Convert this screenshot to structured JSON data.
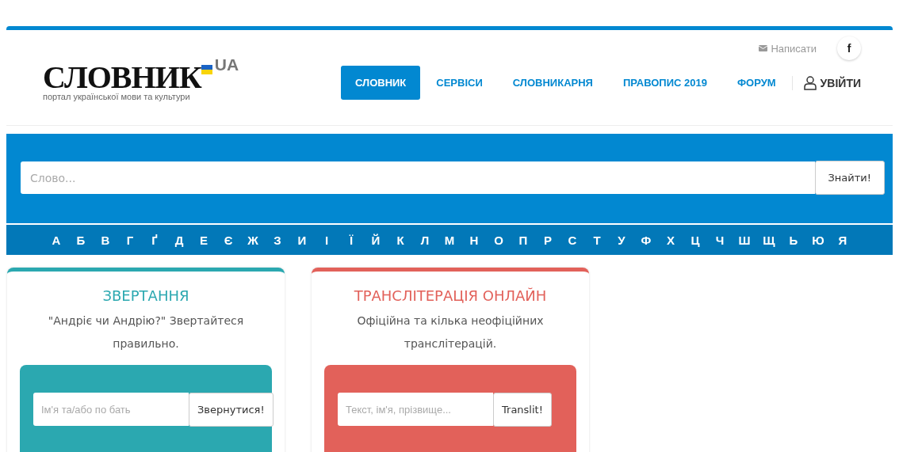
{
  "logo": {
    "title": "СЛОВНИК",
    "suffix": "UA",
    "tagline": "портал української мови та культури"
  },
  "top_links": {
    "write": "Написати",
    "social": "f"
  },
  "nav": [
    {
      "label": "СЛОВНИК",
      "selected": true
    },
    {
      "label": "СЕРВІСИ",
      "selected": false
    },
    {
      "label": "СЛОВНИКАРНЯ",
      "selected": false
    },
    {
      "label": "ПРАВОПИС 2019",
      "selected": false
    },
    {
      "label": "ФОРУМ",
      "selected": false
    }
  ],
  "login": "УВІЙТИ",
  "search": {
    "placeholder": "Слово...",
    "button": "Знайти!"
  },
  "alphabet": [
    "А",
    "Б",
    "В",
    "Г",
    "Ґ",
    "Д",
    "Е",
    "Є",
    "Ж",
    "З",
    "И",
    "І",
    "Ї",
    "Й",
    "К",
    "Л",
    "М",
    "Н",
    "О",
    "П",
    "Р",
    "С",
    "Т",
    "У",
    "Ф",
    "Х",
    "Ц",
    "Ч",
    "Ш",
    "Щ",
    "Ь",
    "Ю",
    "Я"
  ],
  "cards": [
    {
      "title": "ЗВЕРТАННЯ",
      "text": "\"Андріє чи Андрію?\" Звертайтеся правильно.",
      "color": "#2ba8b0",
      "placeholder": "Ім'я та/або по бать",
      "button": "Звернутися!"
    },
    {
      "title": "ТРАНСЛІТЕРАЦІЯ ОНЛАЙН",
      "text": "Офіційна та кілька неофіційних транслітерацій.",
      "color": "#e2615a",
      "placeholder": "Текст, ім'я, прізвище...",
      "button": "Translit!"
    }
  ]
}
